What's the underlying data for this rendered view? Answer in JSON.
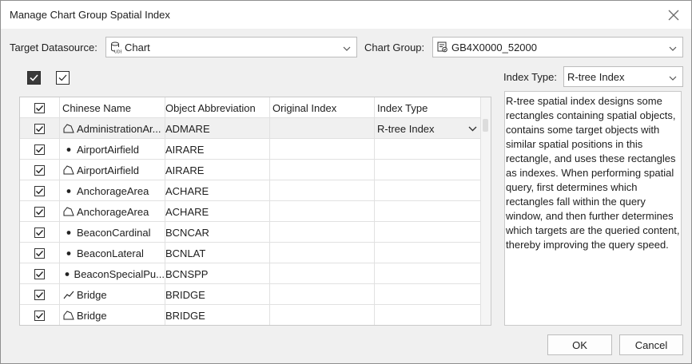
{
  "window": {
    "title": "Manage Chart Group Spatial Index"
  },
  "target_datasource": {
    "label": "Target Datasource:",
    "value": "Chart",
    "icon": "datasource-udb-icon"
  },
  "chart_group": {
    "label": "Chart Group:",
    "value": "GB4X0000_52000",
    "icon": "chart-group-icon"
  },
  "toolbar": {
    "select_all_icon": "select-all-checkbox-icon",
    "invert_icon": "invert-selection-checkbox-icon"
  },
  "index_type": {
    "label": "Index Type:",
    "value": "R-tree Index"
  },
  "table": {
    "headers": [
      "Chinese Name",
      "Object Abbreviation",
      "Original Index",
      "Index Type"
    ],
    "rows": [
      {
        "geometry": "region",
        "name": "AdministrationAr...",
        "abbr": "ADMARE",
        "original": "",
        "index_type": "R-tree Index",
        "selected": true
      },
      {
        "geometry": "point",
        "name": "AirportAirfield",
        "abbr": "AIRARE",
        "original": "",
        "index_type": "",
        "selected": false
      },
      {
        "geometry": "region",
        "name": "AirportAirfield",
        "abbr": "AIRARE",
        "original": "",
        "index_type": "",
        "selected": false
      },
      {
        "geometry": "point",
        "name": "AnchorageArea",
        "abbr": "ACHARE",
        "original": "",
        "index_type": "",
        "selected": false
      },
      {
        "geometry": "region",
        "name": "AnchorageArea",
        "abbr": "ACHARE",
        "original": "",
        "index_type": "",
        "selected": false
      },
      {
        "geometry": "point",
        "name": "BeaconCardinal",
        "abbr": "BCNCAR",
        "original": "",
        "index_type": "",
        "selected": false
      },
      {
        "geometry": "point",
        "name": "BeaconLateral",
        "abbr": "BCNLAT",
        "original": "",
        "index_type": "",
        "selected": false
      },
      {
        "geometry": "point",
        "name": "BeaconSpecialPu...",
        "abbr": "BCNSPP",
        "original": "",
        "index_type": "",
        "selected": false
      },
      {
        "geometry": "line",
        "name": "Bridge",
        "abbr": "BRIDGE",
        "original": "",
        "index_type": "",
        "selected": false
      },
      {
        "geometry": "region",
        "name": "Bridge",
        "abbr": "BRIDGE",
        "original": "",
        "index_type": "",
        "selected": false
      }
    ]
  },
  "description": "R-tree spatial index designs some rectangles containing spatial objects, contains some target objects with similar spatial positions in this rectangle, and uses these rectangles as indexes. When performing spatial query, first determines which rectangles fall within the query window, and then further determines which targets are the queried content, thereby improving the query speed.",
  "buttons": {
    "ok": "OK",
    "cancel": "Cancel"
  }
}
